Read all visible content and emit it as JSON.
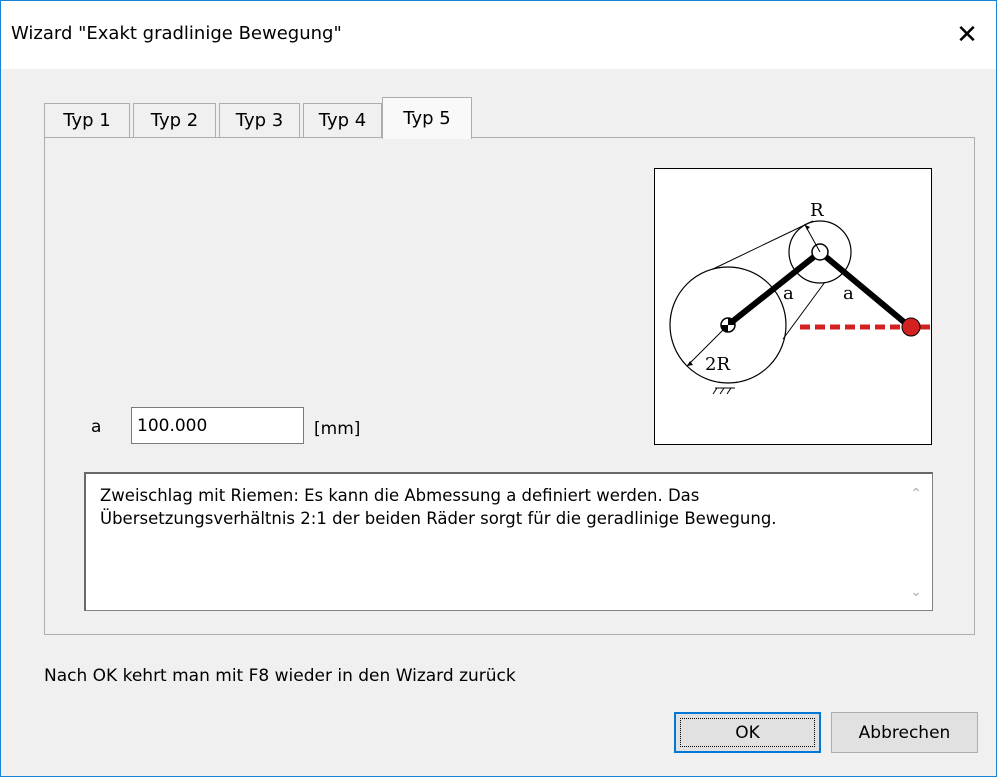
{
  "window": {
    "title": "Wizard \"Exakt gradlinige Bewegung\"",
    "close_glyph": "✕"
  },
  "tabs": [
    {
      "label": "Typ 1",
      "active": false
    },
    {
      "label": "Typ 2",
      "active": false
    },
    {
      "label": "Typ 3",
      "active": false
    },
    {
      "label": "Typ 4",
      "active": false
    },
    {
      "label": "Typ 5",
      "active": true
    }
  ],
  "diagram": {
    "label_R": "R",
    "label_2R": "2R",
    "label_a_left": "a",
    "label_a_right": "a",
    "accent_color": "#d32020"
  },
  "parameter": {
    "label": "a",
    "value": "100.000",
    "unit": "[mm]"
  },
  "description": {
    "text": "Zweischlag mit Riemen: Es kann die Abmessung a definiert werden. Das Übersetzungsverhältnis 2:1 der beiden Räder sorgt für die geradlinige Bewegung.",
    "scroll_up_glyph": "⌃",
    "scroll_down_glyph": "⌄"
  },
  "hint": "Nach OK kehrt man mit F8 wieder in den Wizard zurück",
  "buttons": {
    "ok_label": "OK",
    "cancel_label": "Abbrechen"
  }
}
